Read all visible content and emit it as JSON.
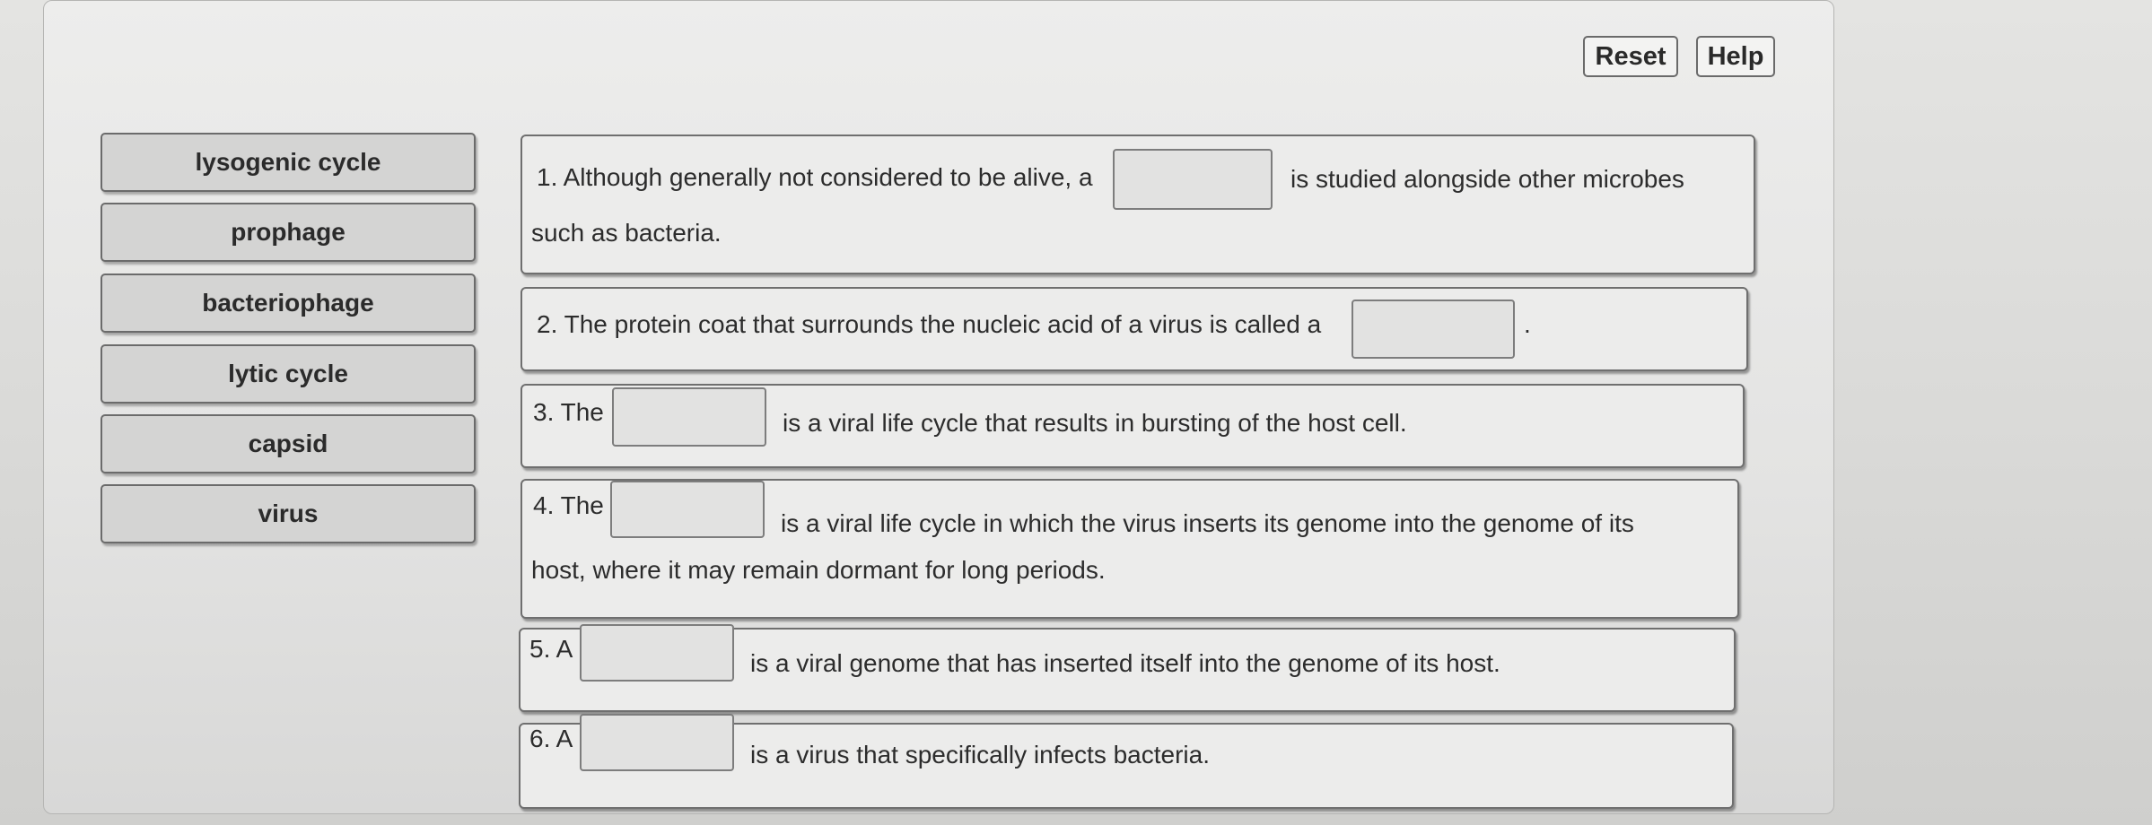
{
  "toolbar": {
    "reset_label": "Reset",
    "help_label": "Help"
  },
  "word_bank": [
    {
      "label": "lysogenic cycle"
    },
    {
      "label": "prophage"
    },
    {
      "label": "bacteriophage"
    },
    {
      "label": "lytic cycle"
    },
    {
      "label": "capsid"
    },
    {
      "label": "virus"
    }
  ],
  "questions": [
    {
      "before": "1. Although generally not considered to be alive, a",
      "after": "is studied alongside other microbes",
      "continuation": "such as bacteria.",
      "answer": ""
    },
    {
      "before": "2. The protein coat that surrounds the nucleic acid of a virus is called a",
      "after": ".",
      "answer": ""
    },
    {
      "before": "3. The",
      "after": "is a viral life cycle that results in bursting of the host cell.",
      "answer": ""
    },
    {
      "before": "4. The",
      "after": "is a viral life cycle in which the virus inserts its genome into the genome of its",
      "continuation": "host, where it may remain dormant for long periods.",
      "answer": ""
    },
    {
      "before": "5. A",
      "after": "is a viral genome that has inserted itself into the genome of its host.",
      "answer": ""
    },
    {
      "before": "6. A",
      "after": "is a virus that specifically infects bacteria.",
      "answer": ""
    }
  ]
}
